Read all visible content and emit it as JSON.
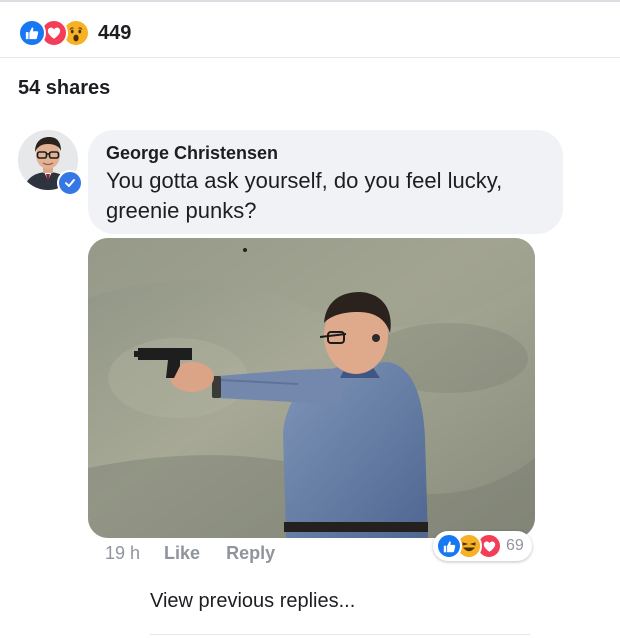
{
  "post": {
    "reactions": {
      "icons": [
        "like-icon",
        "love-icon",
        "wow-icon"
      ],
      "count": "449"
    },
    "shares_label": "54 shares"
  },
  "comment": {
    "author": "George Christensen",
    "verified": true,
    "text": "You gotta ask yourself, do you feel lucky, greenie punks?",
    "photo": "photo-man-aiming-handgun",
    "time": "19 h",
    "like_label": "Like",
    "reply_label": "Reply",
    "reactions": {
      "icons": [
        "like-icon",
        "haha-icon",
        "love-icon"
      ],
      "count": "69"
    }
  },
  "view_previous_label": "View previous replies...",
  "colors": {
    "like": "#1877f2",
    "love": "#f33e58",
    "wow": "#f7b125",
    "bubble": "#f0f2f5",
    "meta_text": "#90949c"
  }
}
